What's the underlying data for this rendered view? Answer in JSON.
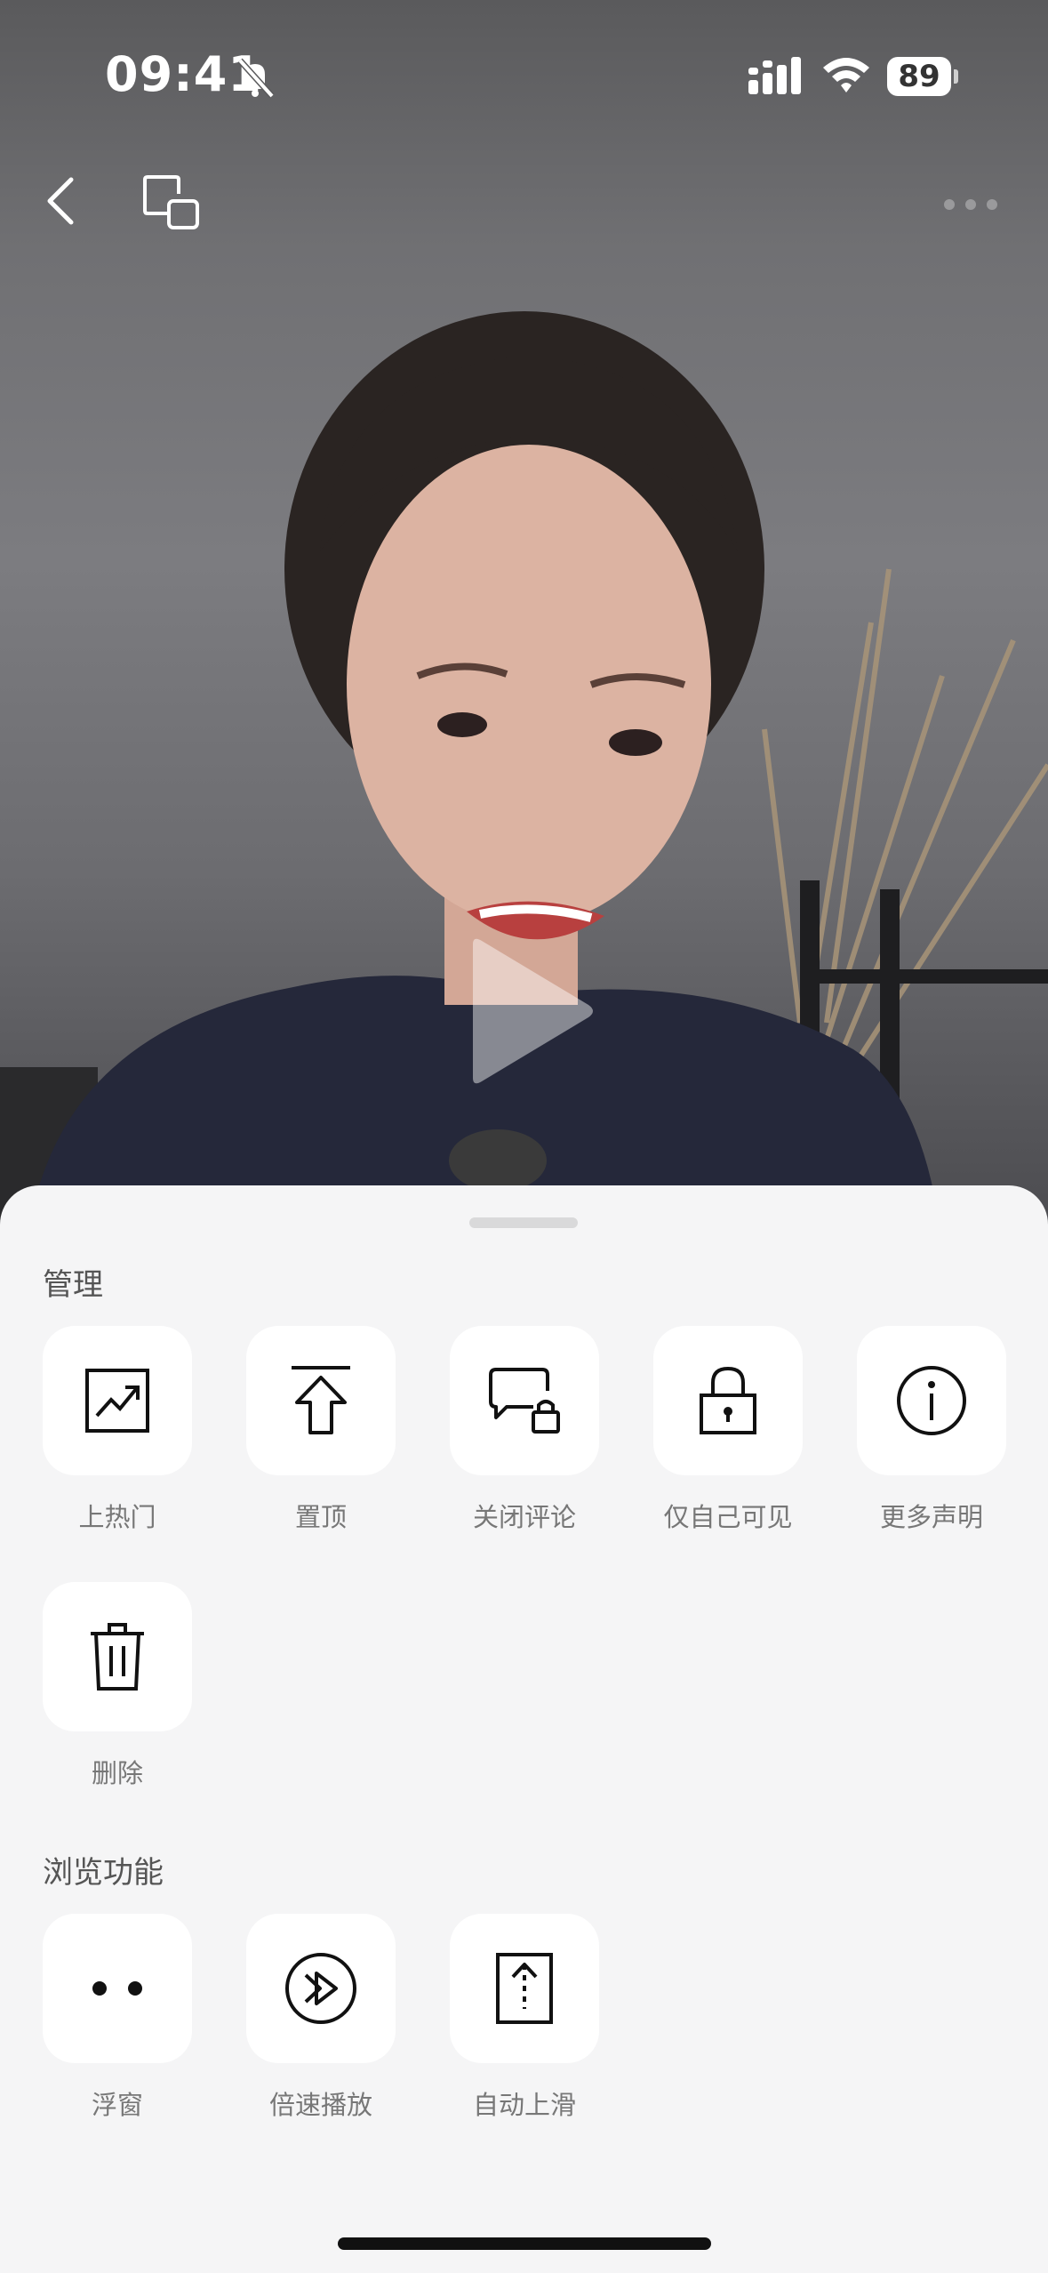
{
  "status_bar": {
    "time": "09:41",
    "battery": "89"
  },
  "sheet": {
    "sections": [
      {
        "title": "管理",
        "items": [
          {
            "label": "上热门",
            "icon": "trending-chart-icon"
          },
          {
            "label": "置顶",
            "icon": "pin-top-icon"
          },
          {
            "label": "关闭评论",
            "icon": "comment-lock-icon"
          },
          {
            "label": "仅自己可见",
            "icon": "lock-icon"
          },
          {
            "label": "更多声明",
            "icon": "info-icon"
          },
          {
            "label": "删除",
            "icon": "trash-icon"
          }
        ]
      },
      {
        "title": "浏览功能",
        "items": [
          {
            "label": "浮窗",
            "icon": "floating-window-icon"
          },
          {
            "label": "倍速播放",
            "icon": "fast-forward-icon"
          },
          {
            "label": "自动上滑",
            "icon": "auto-scroll-icon"
          }
        ]
      }
    ]
  }
}
